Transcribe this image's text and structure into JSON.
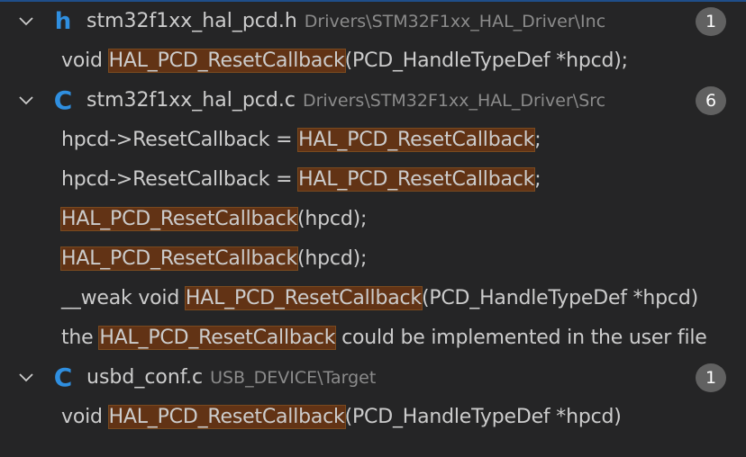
{
  "results": [
    {
      "icon": "h-header-icon",
      "icon_glyph": "h",
      "file": "stm32f1xx_hal_pcd.h",
      "path": "Drivers\\STM32F1xx_HAL_Driver\\Inc",
      "count": "1",
      "matches": [
        {
          "pre": "void ",
          "hit": "HAL_PCD_ResetCallback",
          "post": "(PCD_HandleTypeDef *hpcd);"
        }
      ]
    },
    {
      "icon": "c-source-icon",
      "icon_glyph": "C",
      "file": "stm32f1xx_hal_pcd.c",
      "path": "Drivers\\STM32F1xx_HAL_Driver\\Src",
      "count": "6",
      "matches": [
        {
          "pre": "hpcd->ResetCallback = ",
          "hit": "HAL_PCD_ResetCallback",
          "post": ";"
        },
        {
          "pre": "hpcd->ResetCallback = ",
          "hit": "HAL_PCD_ResetCallback",
          "post": ";"
        },
        {
          "pre": "",
          "hit": "HAL_PCD_ResetCallback",
          "post": "(hpcd);"
        },
        {
          "pre": "",
          "hit": "HAL_PCD_ResetCallback",
          "post": "(hpcd);"
        },
        {
          "pre": "__weak void ",
          "hit": "HAL_PCD_ResetCallback",
          "post": "(PCD_HandleTypeDef *hpcd)"
        },
        {
          "pre": "the ",
          "hit": "HAL_PCD_ResetCallback",
          "post": " could be implemented in the user file"
        }
      ]
    },
    {
      "icon": "c-source-icon",
      "icon_glyph": "C",
      "file": "usbd_conf.c",
      "path": "USB_DEVICE\\Target",
      "count": "1",
      "matches": [
        {
          "pre": "void ",
          "hit": "HAL_PCD_ResetCallback",
          "post": "(PCD_HandleTypeDef *hpcd)"
        }
      ]
    }
  ],
  "colors": {
    "background": "#252526",
    "match_highlight": "#623315",
    "icon_blue": "#2f8fe0",
    "badge": "#616161"
  }
}
